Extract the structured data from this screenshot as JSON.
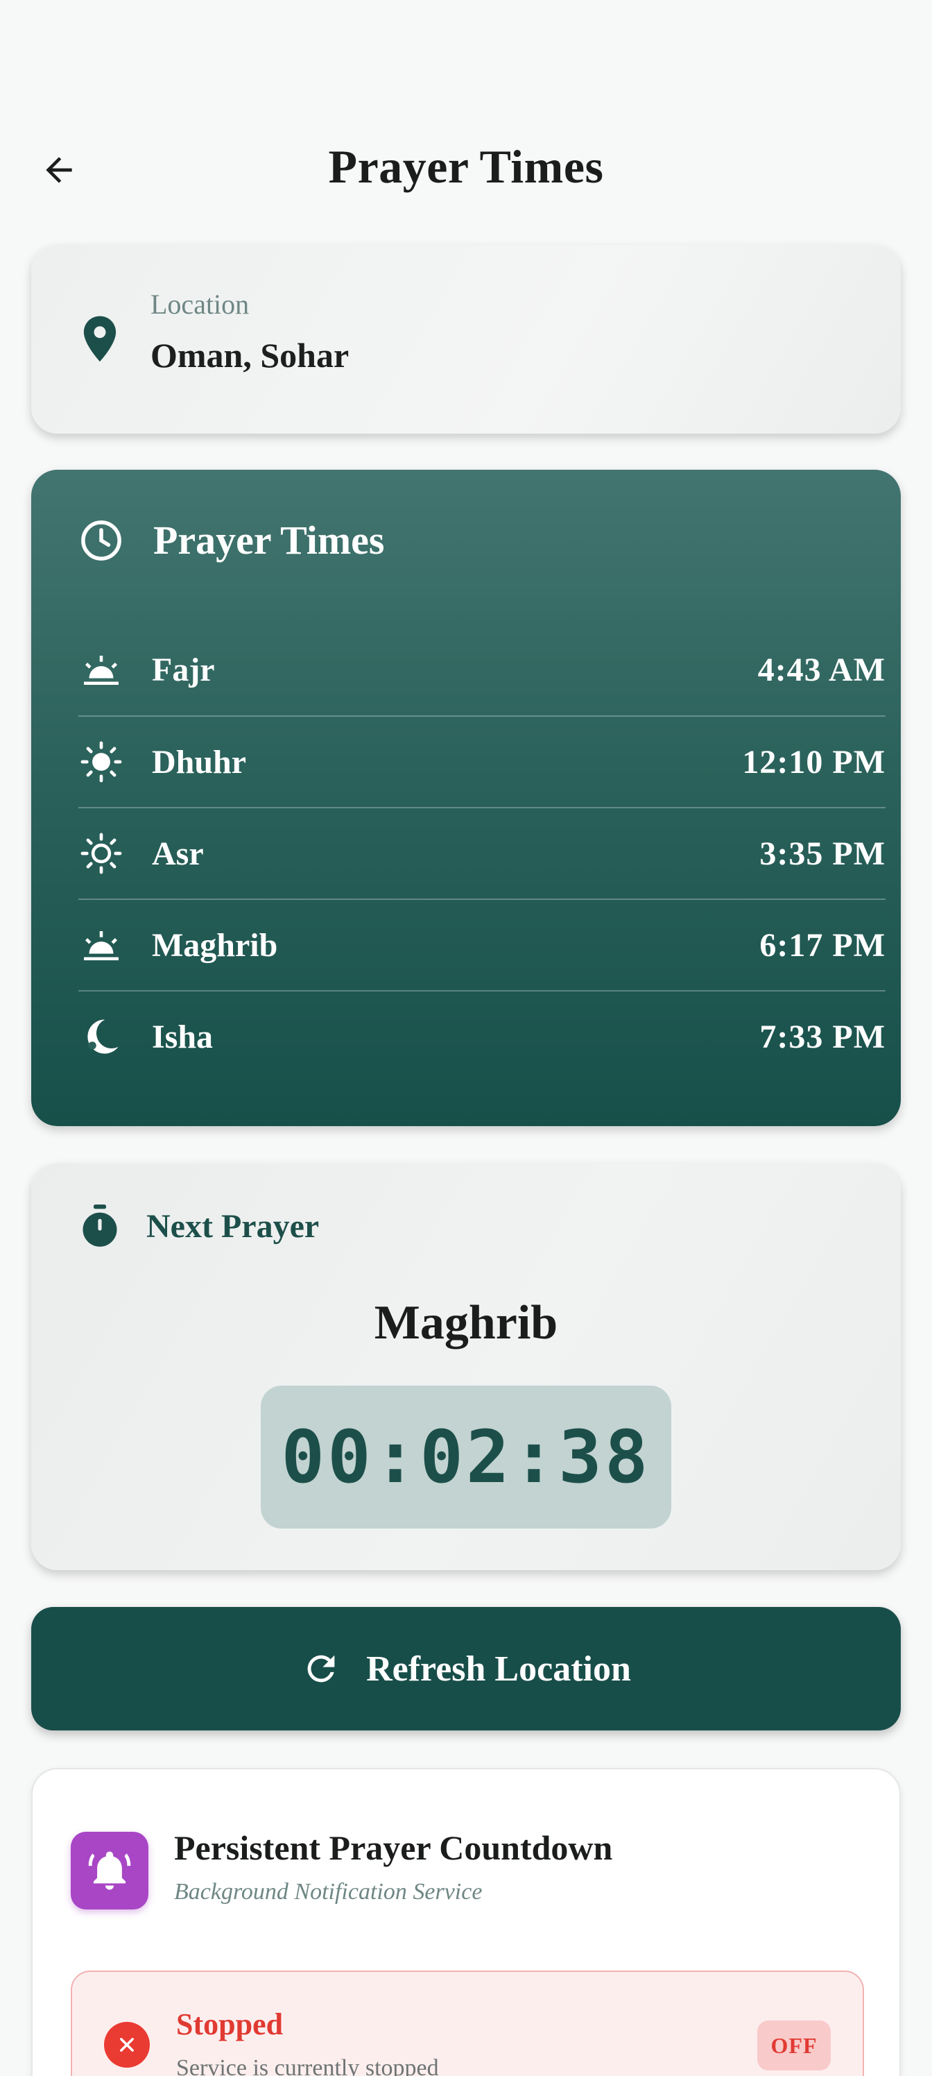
{
  "header": {
    "title": "Prayer Times"
  },
  "location": {
    "label": "Location",
    "value": "Oman, Sohar"
  },
  "prayer_card": {
    "title": "Prayer Times",
    "prayers": [
      {
        "name": "Fajr",
        "time": "4:43 AM",
        "icon": "sunrise-icon"
      },
      {
        "name": "Dhuhr",
        "time": "12:10 PM",
        "icon": "sun-icon"
      },
      {
        "name": "Asr",
        "time": "3:35 PM",
        "icon": "sun-outline-icon"
      },
      {
        "name": "Maghrib",
        "time": "6:17 PM",
        "icon": "sunset-icon"
      },
      {
        "name": "Isha",
        "time": "7:33 PM",
        "icon": "moon-icon"
      }
    ]
  },
  "next_prayer": {
    "label": "Next Prayer",
    "name": "Maghrib",
    "countdown": "00:02:38"
  },
  "refresh_button": {
    "label": "Refresh Location"
  },
  "service": {
    "title": "Persistent Prayer Countdown",
    "subtitle": "Background Notification Service",
    "status_title": "Stopped",
    "status_desc": "Service is currently stopped",
    "badge": "OFF"
  },
  "colors": {
    "primary": "#184e49",
    "accent_purple": "#a846c5",
    "status_red": "#e03a32"
  }
}
